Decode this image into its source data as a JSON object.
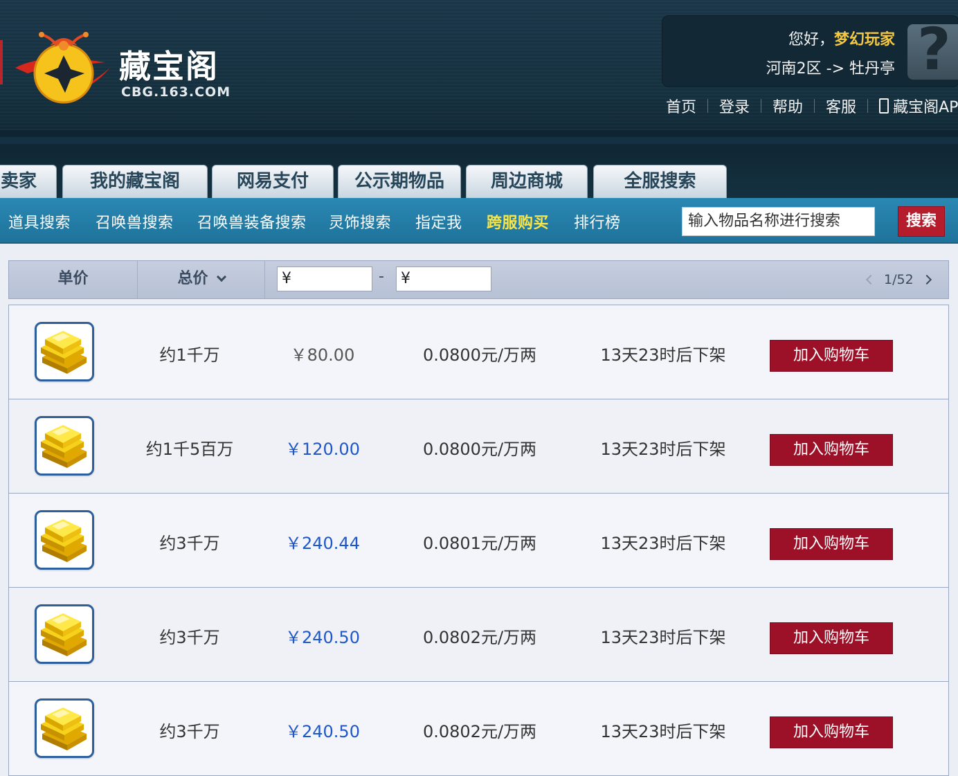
{
  "header": {
    "logo_text": "藏宝阁",
    "logo_sub": "CBG.163.COM",
    "greeting_prefix": "您好，",
    "username": "梦幻玩家",
    "server": "河南2区 -> 牡丹亭",
    "avatar_glyph": "?",
    "nav": [
      "首页",
      "登录",
      "帮助",
      "客服",
      "藏宝阁AP"
    ]
  },
  "tabs": [
    "卖家",
    "我的藏宝阁",
    "网易支付",
    "公示期物品",
    "周边商城",
    "全服搜索"
  ],
  "subnav": {
    "items": [
      "道具搜索",
      "召唤兽搜索",
      "召唤兽装备搜索",
      "灵饰搜索",
      "指定我",
      "跨服购买",
      "排行榜"
    ],
    "search_placeholder": "输入物品名称进行搜索",
    "search_button": "搜索"
  },
  "filter": {
    "unit_price_label": "单价",
    "total_price_label": "总价",
    "min_prefix": "¥",
    "max_prefix": "¥",
    "dash": "-",
    "page": "1/52"
  },
  "listings": [
    {
      "amount": "约1千万",
      "price": "￥80.00",
      "ratio": "0.0800元/万两",
      "time": "13天23时后下架",
      "button": "加入购物车"
    },
    {
      "amount": "约1千5百万",
      "price": "￥120.00",
      "ratio": "0.0800元/万两",
      "time": "13天23时后下架",
      "button": "加入购物车"
    },
    {
      "amount": "约3千万",
      "price": "￥240.44",
      "ratio": "0.0801元/万两",
      "time": "13天23时后下架",
      "button": "加入购物车"
    },
    {
      "amount": "约3千万",
      "price": "￥240.50",
      "ratio": "0.0802元/万两",
      "time": "13天23时后下架",
      "button": "加入购物车"
    },
    {
      "amount": "约3千万",
      "price": "￥240.50",
      "ratio": "0.0802元/万两",
      "time": "13天23时后下架",
      "button": "加入购物车"
    }
  ],
  "icons": {
    "logo": "treasure-pouch-logo",
    "item": "gold-bars-icon",
    "avatar": "question-mark-icon",
    "phone": "phone-icon",
    "sort": "chevron-down-icon",
    "pager_prev": "chevron-left-icon",
    "pager_next": "chevron-right-icon"
  },
  "colors": {
    "header_bg": "#15303f",
    "subnav_bg": "#2a88b3",
    "username": "#f5c842",
    "hot_link": "#f7e54a",
    "search_button": "#b51c2c",
    "cart_button": "#9d1128",
    "price_blue": "#1f56c8"
  }
}
